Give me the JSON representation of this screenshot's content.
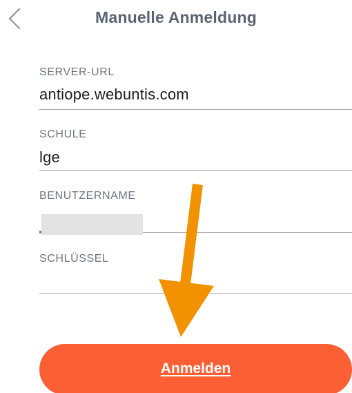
{
  "header": {
    "title": "Manuelle Anmeldung",
    "back_icon": "chevron-left-icon"
  },
  "form": {
    "server_url": {
      "label": "SERVER-URL",
      "value": "antiope.webuntis.com"
    },
    "school": {
      "label": "SCHULE",
      "value": "lge"
    },
    "username": {
      "label": "BENUTZERNAME",
      "value": ""
    },
    "key": {
      "label": "SCHLÜSSEL",
      "value": ""
    }
  },
  "actions": {
    "login_label": "Anmelden",
    "login_color": "#fb5f33"
  },
  "annotation": {
    "arrow_color": "#f39200",
    "arrow_icon": "arrow-down-icon"
  },
  "colors": {
    "title": "#5b6472",
    "label": "#6d7480",
    "value": "#1d1d1f",
    "divider": "#a9a9a9"
  }
}
